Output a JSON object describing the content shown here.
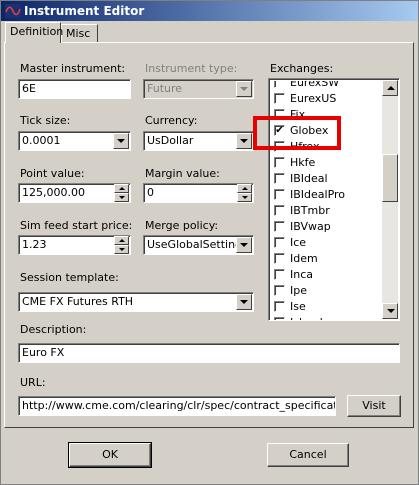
{
  "window": {
    "title": "Instrument Editor"
  },
  "tabs": [
    {
      "label": "Definition",
      "active": true
    },
    {
      "label": "Misc",
      "active": false
    }
  ],
  "form": {
    "master_instrument": {
      "label": "Master instrument:",
      "value": "6E"
    },
    "instrument_type": {
      "label": "Instrument type:",
      "value": "Future",
      "disabled": true
    },
    "tick_size": {
      "label": "Tick size:",
      "value": "0.0001"
    },
    "currency": {
      "label": "Currency:",
      "value": "UsDollar"
    },
    "point_value": {
      "label": "Point value:",
      "value": "125,000.00"
    },
    "margin_value": {
      "label": "Margin value:",
      "value": "0"
    },
    "sim_feed_start_price": {
      "label": "Sim feed start price:",
      "value": "1.23"
    },
    "merge_policy": {
      "label": "Merge policy:",
      "value": "UseGlobalSettings"
    },
    "session_template": {
      "label": "Session template:",
      "value": "CME FX Futures RTH"
    },
    "description": {
      "label": "Description:",
      "value": "Euro FX"
    },
    "url": {
      "label": "URL:",
      "value": "http://www.cme.com/clearing/clr/spec/contract_specifications_a"
    },
    "visit_label": "Visit"
  },
  "exchanges": {
    "label": "Exchanges:",
    "items": [
      {
        "name": "EurexSW",
        "checked": false
      },
      {
        "name": "EurexUS",
        "checked": false
      },
      {
        "name": "Fix",
        "checked": false
      },
      {
        "name": "Globex",
        "checked": true
      },
      {
        "name": "Hfrex",
        "checked": false
      },
      {
        "name": "Hkfe",
        "checked": false
      },
      {
        "name": "IBIdeal",
        "checked": false
      },
      {
        "name": "IBIdealPro",
        "checked": false
      },
      {
        "name": "IBTmbr",
        "checked": false
      },
      {
        "name": "IBVwap",
        "checked": false
      },
      {
        "name": "Ice",
        "checked": false
      },
      {
        "name": "Idem",
        "checked": false
      },
      {
        "name": "Inca",
        "checked": false
      },
      {
        "name": "Ipe",
        "checked": false
      },
      {
        "name": "Ise",
        "checked": false
      },
      {
        "name": "Island",
        "checked": false
      }
    ]
  },
  "buttons": {
    "ok": "OK",
    "cancel": "Cancel"
  },
  "colors": {
    "highlight": "#e60000",
    "titlebar": "#0a246a",
    "face": "#d4d0c8"
  },
  "icons": {
    "app": "app-logo-icon",
    "dropdown": "chevron-down-icon",
    "spin_up": "spin-up-icon",
    "spin_down": "spin-down-icon",
    "checked": "checkmark-icon"
  }
}
